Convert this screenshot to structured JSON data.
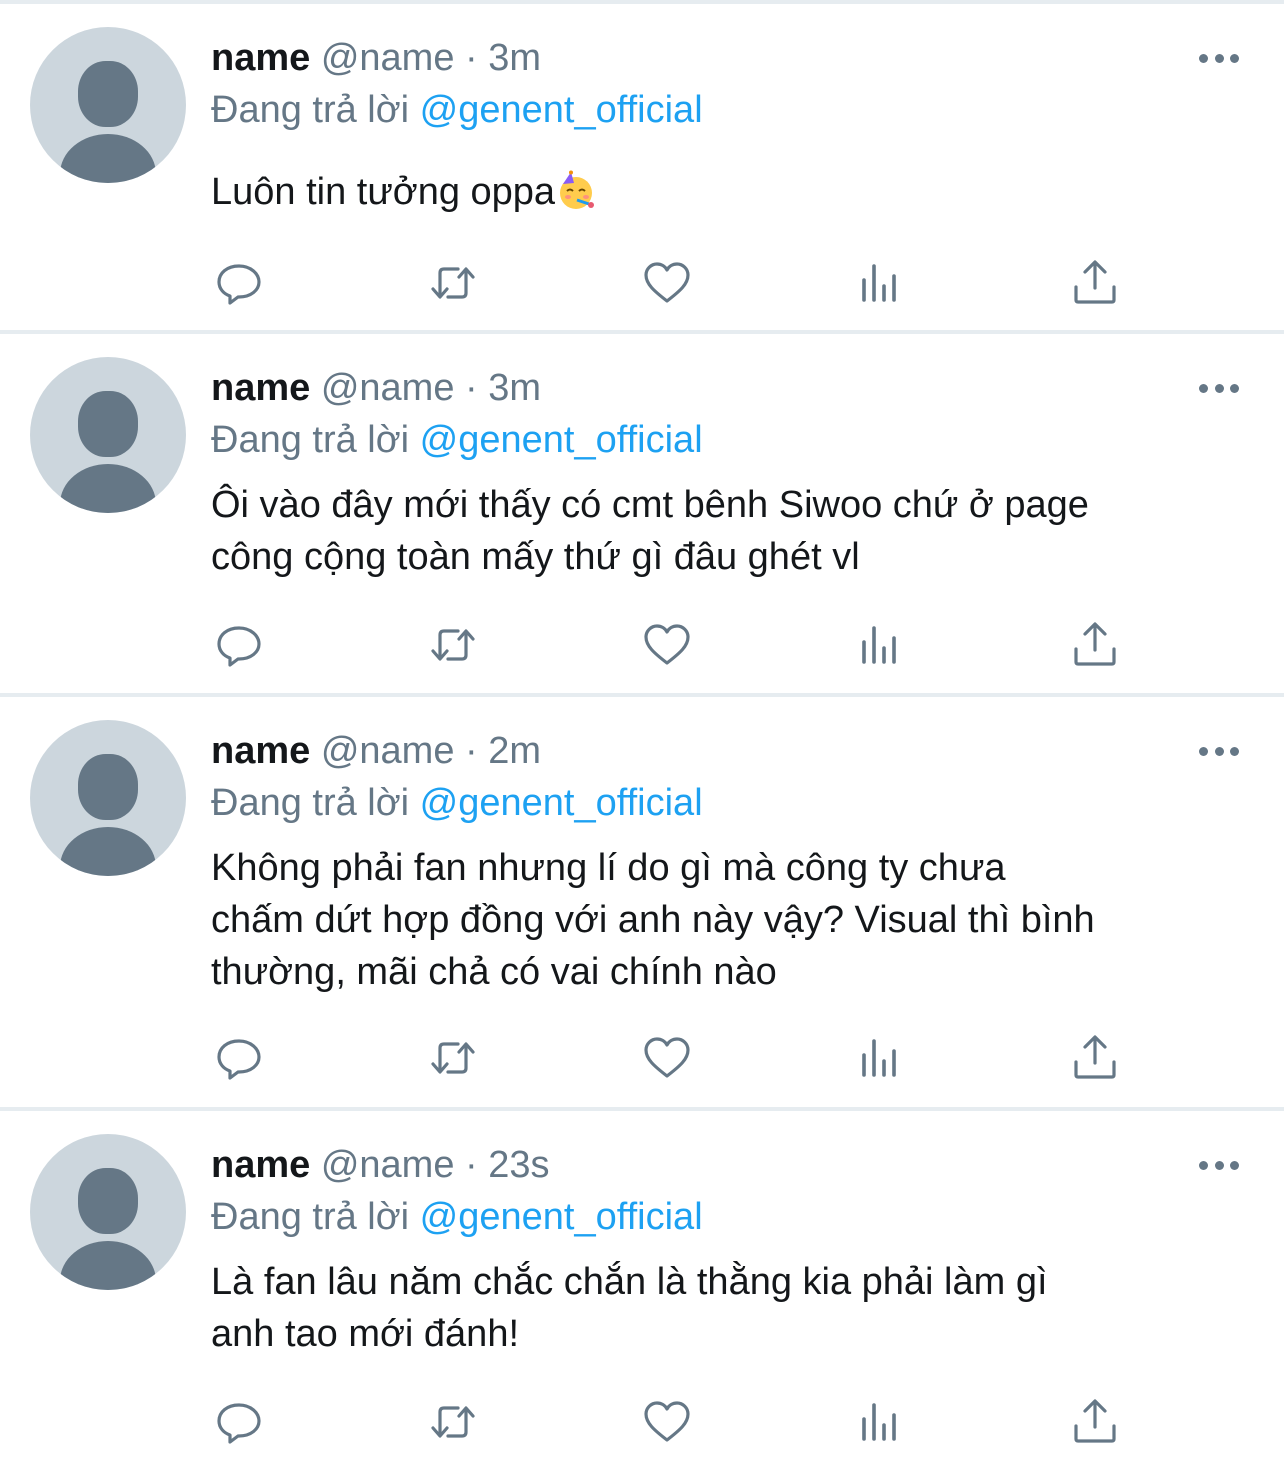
{
  "colors": {
    "text": "#14171a",
    "secondary": "#657786",
    "link": "#1da1f2",
    "separator": "#e6ecf0",
    "avatar_bg": "#ccd6dd"
  },
  "tweets": [
    {
      "name": "name",
      "handle": "@name",
      "separator": "·",
      "time": "3m",
      "reply_prefix": "Đang trả lời",
      "reply_to": "@genent_official",
      "text": "Luôn tin tưởng oppa",
      "emoji": "partying-face-emoji"
    },
    {
      "name": "name",
      "handle": "@name",
      "separator": "·",
      "time": "3m",
      "reply_prefix": "Đang trả lời",
      "reply_to": "@genent_official",
      "text_lines": [
        "Ôi vào đây mới thấy có cmt bênh Siwoo chứ ở page",
        "công cộng toàn mấy thứ gì đâu ghét vl"
      ]
    },
    {
      "name": "name",
      "handle": "@name",
      "separator": "·",
      "time": "2m",
      "reply_prefix": "Đang trả lời",
      "reply_to": "@genent_official",
      "text_lines": [
        "Không phải fan nhưng lí do gì mà công ty chưa",
        "chấm dứt hợp đồng với anh này vậy? Visual thì bình",
        "thường, mãi chả có vai chính nào"
      ]
    },
    {
      "name": "name",
      "handle": "@name",
      "separator": "·",
      "time": "23s",
      "reply_prefix": "Đang trả lời",
      "reply_to": "@genent_official",
      "text_lines": [
        "Là fan lâu năm chắc chắn là thằng kia phải làm gì",
        "anh tao mới đánh!"
      ]
    }
  ],
  "action_icons": [
    "reply-icon",
    "retweet-icon",
    "like-icon",
    "analytics-icon",
    "share-icon"
  ]
}
